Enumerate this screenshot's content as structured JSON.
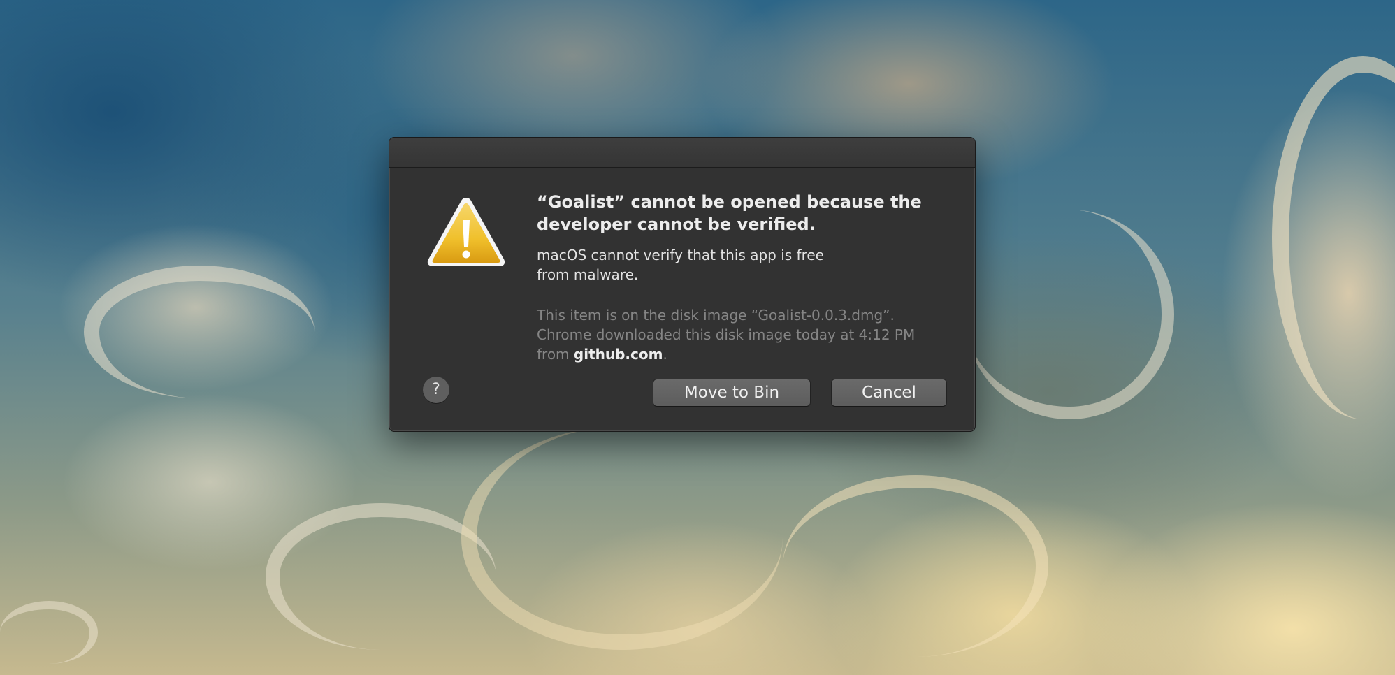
{
  "alert": {
    "title_lines": [
      "“Goalist” cannot be opened because the",
      "developer cannot be verified."
    ],
    "message_lines": [
      "macOS cannot verify that this app is free",
      "from malware."
    ],
    "info": {
      "line1": "This item is on the disk image “Goalist-0.0.3.dmg”.",
      "line2": "Chrome downloaded this disk image today at 4:12 PM",
      "line3_prefix": "from ",
      "source_domain": "github.com",
      "line3_suffix": "."
    }
  },
  "buttons": {
    "help_label": "?",
    "move_to_bin_label": "Move to Bin",
    "cancel_label": "Cancel"
  },
  "icons": {
    "alert_icon": "warning-triangle",
    "alert_icon_color": "#f2c230"
  },
  "colors": {
    "dialog_background": "#323232",
    "button_background": "#636363"
  }
}
